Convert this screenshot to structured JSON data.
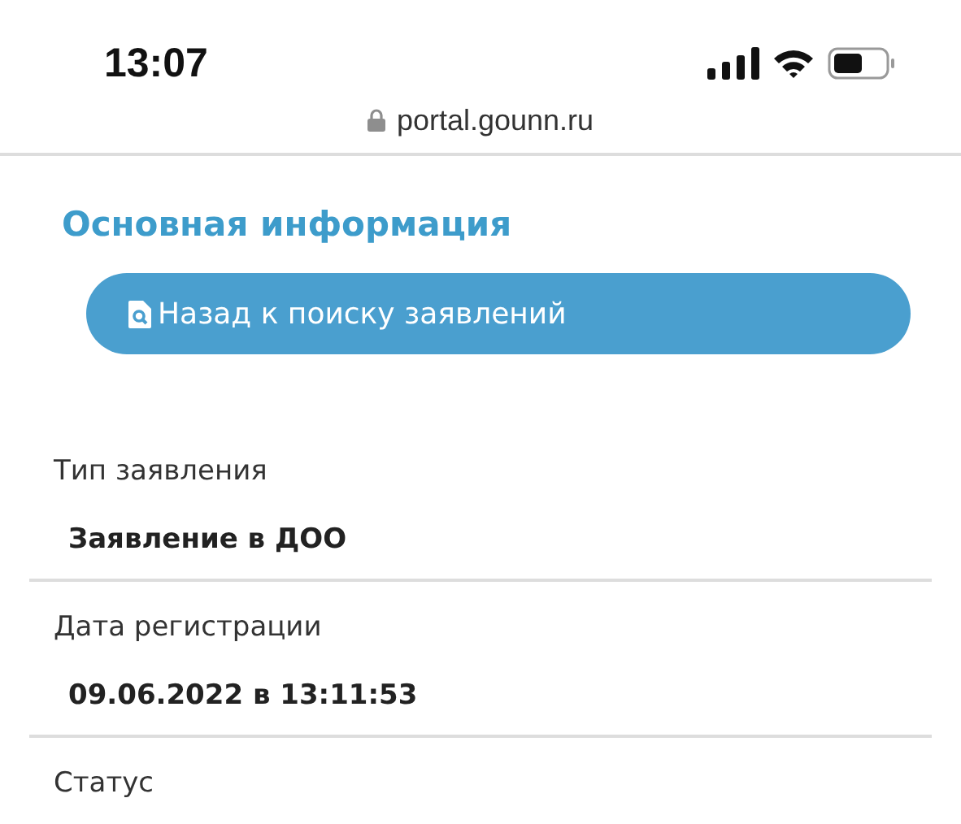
{
  "status_bar": {
    "time": "13:07"
  },
  "address_bar": {
    "url": "portal.gounn.ru"
  },
  "heading": "Основная информация",
  "back_button": {
    "label": "Назад к поиску заявлений"
  },
  "fields": [
    {
      "label": "Тип заявления",
      "value": "Заявление в ДОО"
    },
    {
      "label": "Дата регистрации",
      "value": "09.06.2022 в 13:11:53"
    },
    {
      "label": "Статус"
    }
  ]
}
